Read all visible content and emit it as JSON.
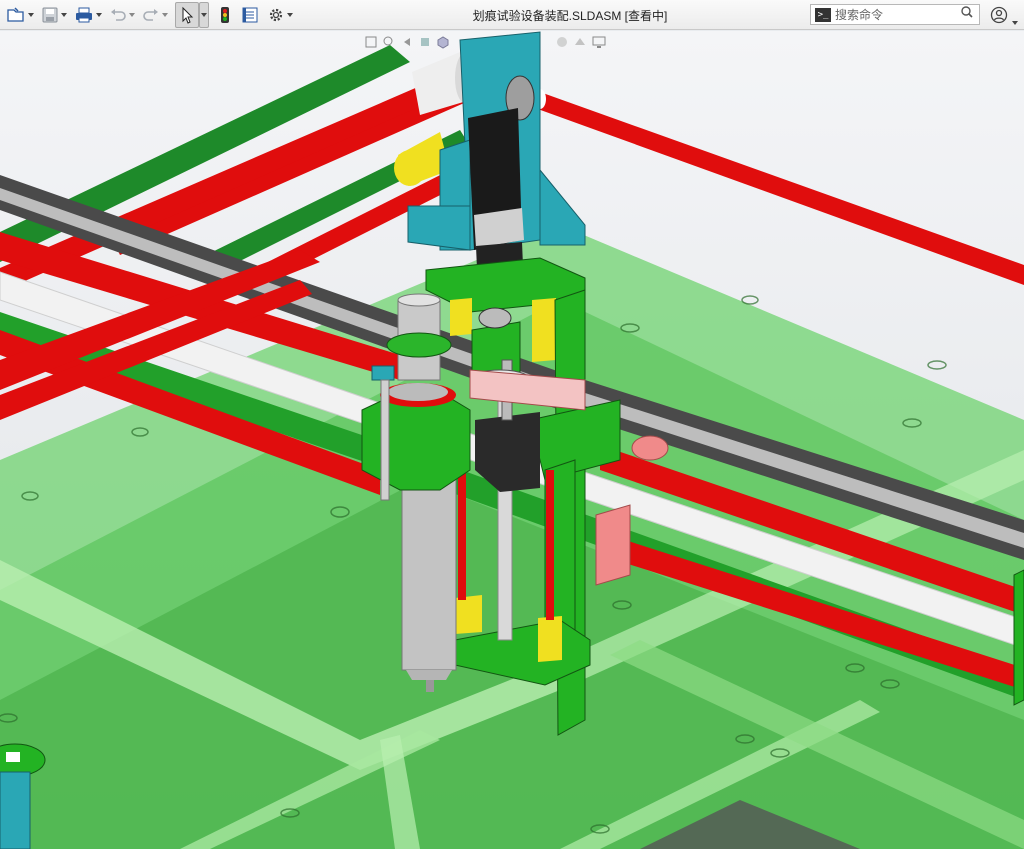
{
  "window": {
    "title": "划痕试验设备装配.SLDASM [查看中]"
  },
  "toolbar": {
    "items": [
      {
        "name": "open-file-icon",
        "has_dropdown": true
      },
      {
        "name": "save-icon",
        "has_dropdown": true
      },
      {
        "name": "print-icon",
        "has_dropdown": true
      },
      {
        "name": "undo-icon",
        "has_dropdown": true
      },
      {
        "name": "redo-icon",
        "has_dropdown": true
      },
      {
        "name": "select-pointer-icon",
        "has_dropdown": true,
        "selected": true
      },
      {
        "name": "traffic-light-icon",
        "has_dropdown": false
      },
      {
        "name": "file-properties-icon",
        "has_dropdown": false
      },
      {
        "name": "options-gear-icon",
        "has_dropdown": true
      }
    ]
  },
  "search": {
    "placeholder": "搜索命令"
  },
  "heads_up_toolbar": {
    "icons": [
      "zoom-to-fit-icon",
      "zoom-area-icon",
      "previous-view-icon",
      "section-view-icon",
      "view-orientation-icon",
      "display-style-icon",
      "hide-show-icon",
      "edit-appearance-icon",
      "apply-scene-icon",
      "view-settings-icon"
    ]
  },
  "colors": {
    "viewport_bg_top": "#f4f5f7",
    "viewport_bg_bottom": "#dfe2e6",
    "frame_green": "#2fb02f",
    "transparent_green": "#6fd36f",
    "rod_red": "#e00d0d",
    "rod_white": "#f2f2f2",
    "teal": "#2aa7b5",
    "yellow": "#f0e020",
    "steel_gray": "#c9c9c9",
    "motor_black": "#1a1a1a"
  }
}
